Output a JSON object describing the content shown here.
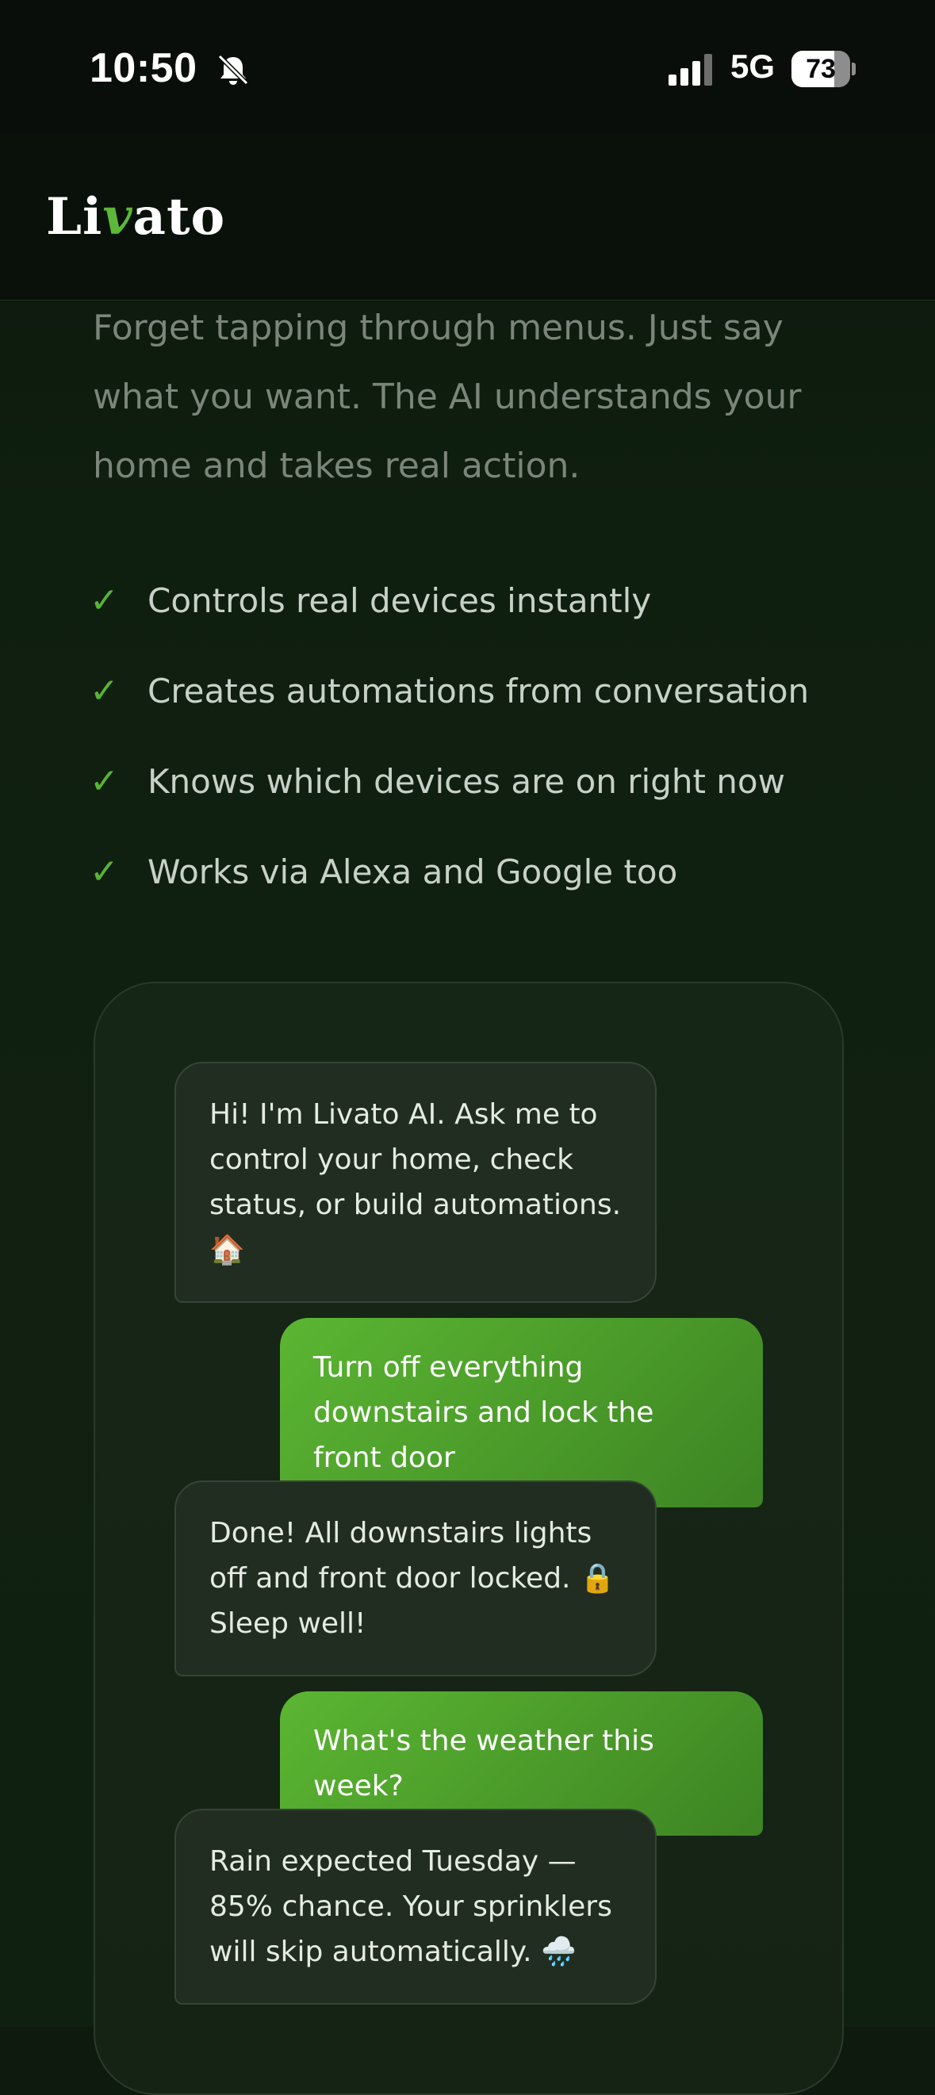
{
  "status_bar": {
    "time": "10:50",
    "network": "5G",
    "battery_percent": 73,
    "battery_label": "73"
  },
  "header": {
    "logo_prefix": "Li",
    "logo_accent": "v",
    "logo_suffix": "ato"
  },
  "intro": {
    "text": "Forget tapping through menus. Just say what you want. The AI understands your home and takes real action."
  },
  "features": [
    "Controls real devices instantly",
    "Creates automations from conversation",
    "Knows which devices are on right now",
    "Works via Alexa and Google too"
  ],
  "chat": {
    "messages": [
      {
        "role": "ai",
        "text": "Hi! I'm Livato AI. Ask me to control your home, check status, or build automations. 🏠"
      },
      {
        "role": "user",
        "text": "Turn off everything downstairs and lock the front door"
      },
      {
        "role": "ai",
        "text": "Done! All downstairs lights off and front door locked. 🔒 Sleep well!"
      },
      {
        "role": "user",
        "text": "What's the weather this week?"
      },
      {
        "role": "ai",
        "text": "Rain expected Tuesday — 85% chance. Your sprinklers will skip automatically. 🌧️"
      }
    ]
  },
  "colors": {
    "accent": "#5cb83a",
    "background": "#0d1a0d"
  }
}
